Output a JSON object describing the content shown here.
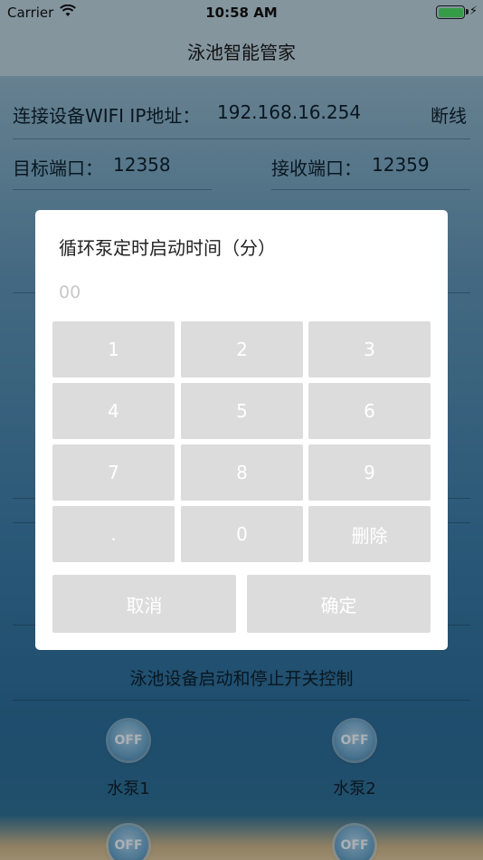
{
  "status_bar": {
    "carrier": "Carrier",
    "time": "10:58 AM"
  },
  "nav": {
    "title": "泳池智能管家"
  },
  "connection": {
    "wifi_label": "连接设备WIFI IP地址：",
    "wifi_ip": "192.168.16.254",
    "disconnect": "断线",
    "target_port_label": "目标端口：",
    "target_port": "12358",
    "receive_port_label": "接收端口：",
    "receive_port": "12359"
  },
  "switch_section": {
    "title": "泳池设备启动和停止开关控制"
  },
  "pumps": [
    {
      "state": "OFF",
      "label": "水泵1"
    },
    {
      "state": "OFF",
      "label": "水泵2"
    },
    {
      "state": "OFF"
    },
    {
      "state": "OFF"
    }
  ],
  "dialog": {
    "title": "循环泵定时启动时间（分）",
    "input_placeholder": "00",
    "keys": [
      "1",
      "2",
      "3",
      "4",
      "5",
      "6",
      "7",
      "8",
      "9",
      ".",
      "0",
      "删除"
    ],
    "cancel": "取消",
    "confirm": "确定"
  },
  "colors": {
    "key_bg": "#dcdcdc",
    "battery": "#4cd964"
  }
}
